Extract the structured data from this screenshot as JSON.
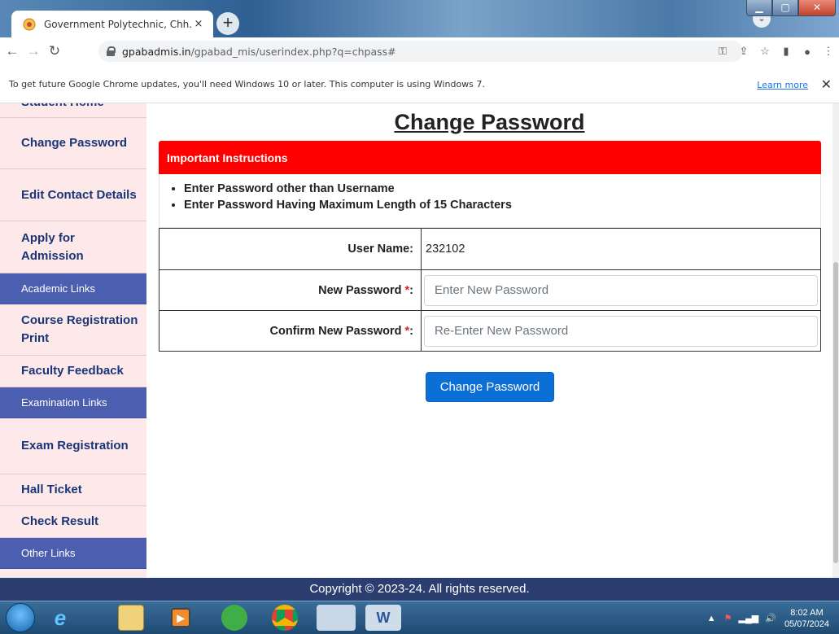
{
  "browser": {
    "tab_title": "Government Polytechnic, Chh. Sa",
    "tab_close": "×",
    "new_tab": "+",
    "url_host": "gpabadmis.in",
    "url_path": "/gpabad_mis/userindex.php?q=chpass#",
    "infobar_text": "To get future Google Chrome updates, you'll need Windows 10 or later. This computer is using Windows 7.",
    "infobar_link": "Learn more",
    "infobar_close": "✕"
  },
  "sidebar": {
    "cut_item": "Student Home",
    "items": [
      {
        "type": "item",
        "label": "Change Password"
      },
      {
        "type": "item",
        "label": "Edit Contact Details"
      },
      {
        "type": "item",
        "label": "Apply for Admission"
      },
      {
        "type": "head",
        "label": "Academic Links"
      },
      {
        "type": "item",
        "label": "Course Registration Print"
      },
      {
        "type": "item",
        "label": "Faculty Feedback"
      },
      {
        "type": "head",
        "label": "Examination Links"
      },
      {
        "type": "item",
        "label": "Exam Registration"
      },
      {
        "type": "item",
        "label": "Hall Ticket"
      },
      {
        "type": "item",
        "label": "Check Result"
      },
      {
        "type": "head",
        "label": "Other Links"
      }
    ]
  },
  "main": {
    "title": "Change Password",
    "instructions_title": "Important Instructions",
    "instructions": [
      "Enter Password other than Username",
      "Enter Password Having Maximum Length of 15 Characters"
    ],
    "username_label": "User Name:",
    "username_value": "232102",
    "new_password_label": "New Password",
    "new_password_placeholder": "Enter New Password",
    "confirm_password_label": "Confirm New Password",
    "confirm_password_placeholder": "Re-Enter New Password",
    "required_mark": "*",
    "label_colon": ":",
    "submit_label": "Change Password"
  },
  "footer": {
    "text": "Copyright © 2023-24. All rights reserved."
  },
  "taskbar": {
    "time": "8:02 AM",
    "date": "05/07/2024",
    "apps": [
      "internet-explorer-icon",
      "file-explorer-icon",
      "media-player-icon",
      "wifi-manager-icon",
      "chrome-icon",
      "chrome-profile-icon",
      "word-icon"
    ]
  },
  "colors": {
    "sidebar_bg": "#fde9e9",
    "sidebar_link": "#1a3578",
    "sidebar_head": "#4c5eaf",
    "instructions_bg": "#ff0000",
    "button": "#0b6fd6",
    "footer_bg": "#2c3e6f"
  }
}
